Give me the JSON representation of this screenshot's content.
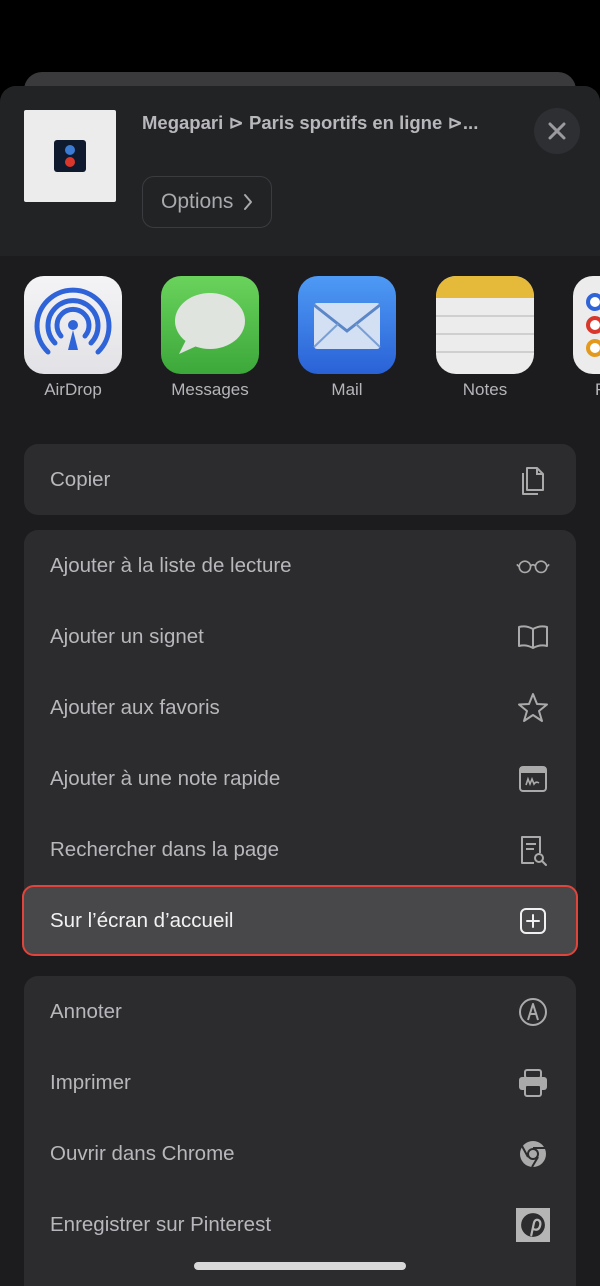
{
  "header": {
    "title": "Megapari ⊳ Paris sportifs en ligne ⊳...",
    "options_label": "Options",
    "close_icon": "close-icon"
  },
  "apps": [
    {
      "label": "AirDrop",
      "icon": "airdrop-icon"
    },
    {
      "label": "Messages",
      "icon": "messages-icon"
    },
    {
      "label": "Mail",
      "icon": "mail-icon"
    },
    {
      "label": "Notes",
      "icon": "notes-icon"
    },
    {
      "label": "R",
      "icon": "reminders-icon"
    }
  ],
  "actions": {
    "group1": [
      {
        "label": "Copier",
        "icon": "copy-icon"
      }
    ],
    "group2": [
      {
        "label": "Ajouter à la liste de lecture",
        "icon": "glasses-icon"
      },
      {
        "label": "Ajouter un signet",
        "icon": "book-icon"
      },
      {
        "label": "Ajouter aux favoris",
        "icon": "star-icon"
      },
      {
        "label": "Ajouter à une note rapide",
        "icon": "quick-note-icon"
      },
      {
        "label": "Rechercher dans la page",
        "icon": "find-in-page-icon"
      },
      {
        "label": "Sur l’écran d’accueil",
        "icon": "add-square-icon",
        "highlighted": true
      }
    ],
    "group3": [
      {
        "label": "Annoter",
        "icon": "markup-icon"
      },
      {
        "label": "Imprimer",
        "icon": "printer-icon"
      },
      {
        "label": "Ouvrir dans Chrome",
        "icon": "chrome-icon"
      },
      {
        "label": "Enregistrer sur Pinterest",
        "icon": "pinterest-icon"
      }
    ]
  },
  "colors": {
    "highlight_border": "#e0453c",
    "sheet_bg": "#1c1c1e",
    "row_bg": "#2c2c2e"
  }
}
